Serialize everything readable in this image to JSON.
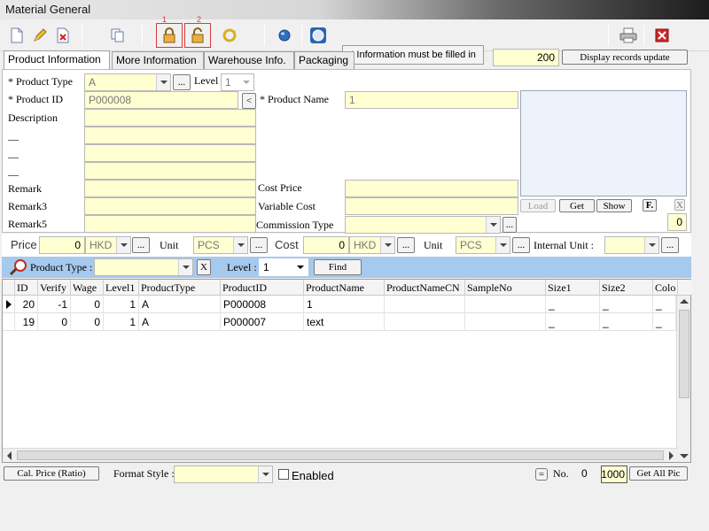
{
  "window": {
    "title": "Material General"
  },
  "toolbar": {
    "info_label": "* Information must be filled in",
    "lock_numbers": [
      "1",
      "2"
    ]
  },
  "tabs": [
    "Product Information",
    "More Information",
    "Warehouse Info.",
    "Packaging"
  ],
  "records": {
    "count": "200",
    "update_label": "Display records update"
  },
  "form": {
    "product_type_label": "* Product Type",
    "product_type_value": "A",
    "browse": "...",
    "level_label": "Level",
    "level_value": "1",
    "product_id_label": "* Product ID",
    "product_id_value": "P000008",
    "back_btn": "<",
    "product_name_label": "* Product Name",
    "product_name_value": "1",
    "description_label": "Description",
    "dash": "—",
    "remark_label": "Remark",
    "remark3_label": "Remark3",
    "remark5_label": "Remark5",
    "cost_price_label": "Cost Price",
    "variable_cost_label": "Variable Cost",
    "commission_type_label": "Commission Type",
    "load_btn": "Load",
    "get_btn": "Get",
    "show_btn": "Show",
    "f_btn": "F.",
    "x_btn": "X",
    "pic_count": "0"
  },
  "price": {
    "price_label": "Price",
    "price_value": "0",
    "price_currency": "HKD",
    "unit_label": "Unit",
    "price_unit": "PCS",
    "cost_label": "Cost",
    "cost_value": "0",
    "cost_currency": "HKD",
    "cost_unit": "PCS",
    "internal_unit_label": "Internal Unit :"
  },
  "filter": {
    "product_type_label": "Product Type :",
    "clear_btn": "X",
    "level_label": "Level :",
    "level_value": "1",
    "find_btn": "Find"
  },
  "grid": {
    "columns": [
      "ID",
      "Verify",
      "Wage",
      "Level1",
      "ProductType",
      "ProductID",
      "ProductName",
      "ProductNameCN",
      "SampleNo",
      "Size1",
      "Size2",
      "Colo"
    ],
    "rows": [
      {
        "id": "20",
        "verify": "-1",
        "wage": "0",
        "level1": "1",
        "type": "A",
        "pid": "P000008",
        "name": "1",
        "size1": "_",
        "size2": "_",
        "color": "_"
      },
      {
        "id": "19",
        "verify": "0",
        "wage": "0",
        "level1": "1",
        "type": "A",
        "pid": "P000007",
        "name": "text",
        "size1": "_",
        "size2": "_",
        "color": "_"
      }
    ]
  },
  "bottom": {
    "cal_price_btn": "Cal. Price (Ratio)",
    "format_style_label": "Format Style :",
    "enabled_label": "Enabled",
    "eq_btn": "=",
    "no_label": "No.",
    "no_value": "0",
    "pic_limit": "1000",
    "get_all_btn": "Get All Pic"
  },
  "colors": {
    "field_bg": "#ffffd2",
    "filter_bar": "#a6c9ee",
    "highlight_border": "#d43c3c"
  }
}
